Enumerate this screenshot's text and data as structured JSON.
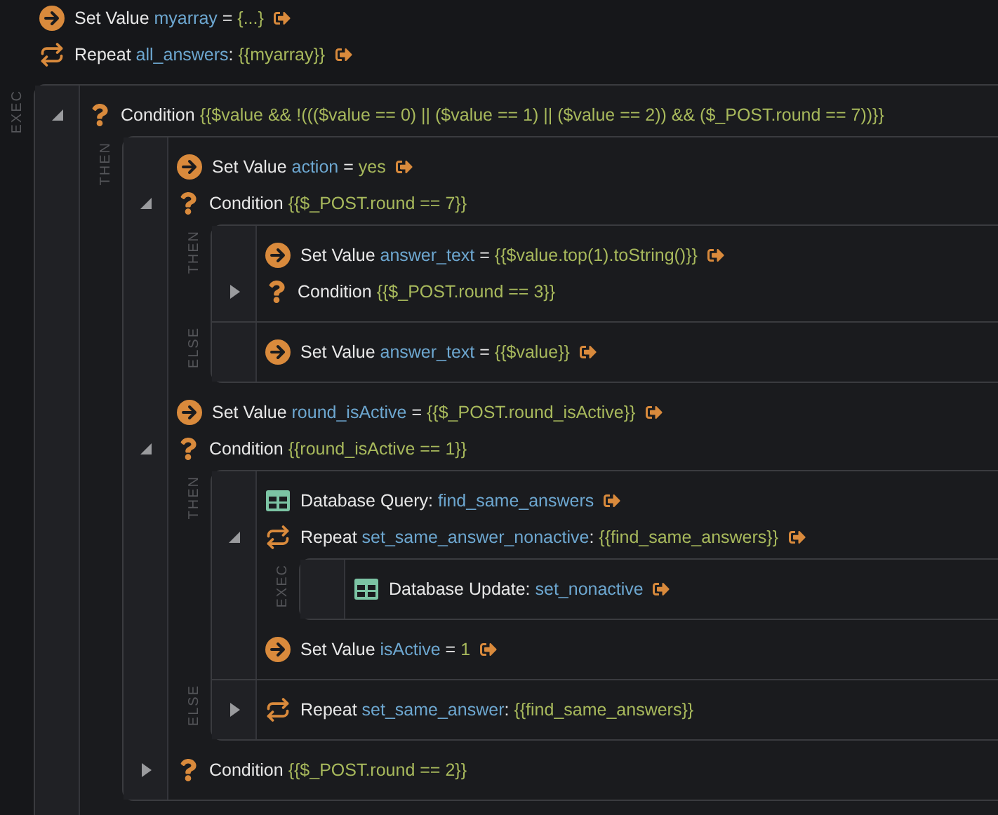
{
  "steps": [
    {
      "kind": "set",
      "action": "Set Value",
      "name": "myarray",
      "separator": "=",
      "value": "{...}",
      "linked": true
    },
    {
      "kind": "repeat",
      "action": "Repeat",
      "name": "all_answers",
      "separator": ":",
      "value": "{{myarray}}",
      "linked": true,
      "branches": [
        {
          "label": "EXEC",
          "steps": [
            {
              "kind": "condition",
              "action": "Condition",
              "value": "{{$value && !((($value == 0) || ($value == 1) || ($value == 2)) && ($_POST.round == 7))}}",
              "expanded": true,
              "branches": [
                {
                  "label": "THEN",
                  "steps": [
                    {
                      "kind": "set",
                      "action": "Set Value",
                      "name": "action",
                      "separator": "=",
                      "value": "yes",
                      "linked": true
                    },
                    {
                      "kind": "condition",
                      "action": "Condition",
                      "value": "{{$_POST.round == 7}}",
                      "expanded": true,
                      "branches": [
                        {
                          "label": "THEN",
                          "steps": [
                            {
                              "kind": "set",
                              "action": "Set Value",
                              "name": "answer_text",
                              "separator": "=",
                              "value": "{{$value.top(1).toString()}}",
                              "linked": true
                            },
                            {
                              "kind": "condition",
                              "action": "Condition",
                              "value": "{{$_POST.round == 3}}",
                              "expanded": false
                            }
                          ]
                        },
                        {
                          "label": "ELSE",
                          "steps": [
                            {
                              "kind": "set",
                              "action": "Set Value",
                              "name": "answer_text",
                              "separator": "=",
                              "value": "{{$value}}",
                              "linked": true
                            }
                          ]
                        }
                      ]
                    },
                    {
                      "kind": "set",
                      "action": "Set Value",
                      "name": "round_isActive",
                      "separator": "=",
                      "value": "{{$_POST.round_isActive}}",
                      "linked": true
                    },
                    {
                      "kind": "condition",
                      "action": "Condition",
                      "value": "{{round_isActive == 1}}",
                      "expanded": true,
                      "branches": [
                        {
                          "label": "THEN",
                          "steps": [
                            {
                              "kind": "query",
                              "action": "Database Query:",
                              "name": "find_same_answers",
                              "linked": true
                            },
                            {
                              "kind": "repeat",
                              "action": "Repeat",
                              "name": "set_same_answer_nonactive",
                              "separator": ":",
                              "value": "{{find_same_answers}}",
                              "linked": true,
                              "expanded": true,
                              "branches": [
                                {
                                  "label": "EXEC",
                                  "steps": [
                                    {
                                      "kind": "query",
                                      "action": "Database Update:",
                                      "name": "set_nonactive",
                                      "linked": true
                                    }
                                  ]
                                }
                              ]
                            },
                            {
                              "kind": "set",
                              "action": "Set Value",
                              "name": "isActive",
                              "separator": "=",
                              "value": "1",
                              "linked": true
                            }
                          ]
                        },
                        {
                          "label": "ELSE",
                          "steps": [
                            {
                              "kind": "repeat",
                              "action": "Repeat",
                              "name": "set_same_answer",
                              "separator": ":",
                              "value": "{{find_same_answers}}",
                              "linked": false,
                              "expanded": false
                            }
                          ]
                        }
                      ]
                    },
                    {
                      "kind": "condition",
                      "action": "Condition",
                      "value": "{{$_POST.round == 2}}",
                      "expanded": false
                    }
                  ]
                }
              ]
            }
          ]
        }
      ]
    }
  ]
}
